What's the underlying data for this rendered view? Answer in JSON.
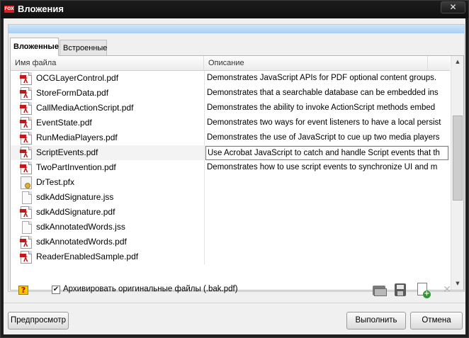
{
  "window": {
    "title": "Вложения",
    "app_icon": "foxit-icon",
    "close_glyph": "✕"
  },
  "tabs": [
    {
      "label": "Вложенные",
      "active": true
    },
    {
      "label": "Встроенные",
      "active": false
    }
  ],
  "table": {
    "columns": [
      "Имя файла",
      "Описание"
    ],
    "rows": [
      {
        "name": "OCGLayerControl.pdf",
        "icon": "pdf-icon",
        "description": "Demonstrates JavaScript APIs for PDF optional content groups."
      },
      {
        "name": "StoreFormData.pdf",
        "icon": "pdf-icon",
        "description": "Demonstrates that a searchable database can be embedded  ins"
      },
      {
        "name": "CallMediaActionScript.pdf",
        "icon": "pdf-icon",
        "description": "Demonstrates the ability to invoke ActionScript methods embed"
      },
      {
        "name": "EventState.pdf",
        "icon": "pdf-icon",
        "description": "Demonstrates two ways for event listeners to have a local persist"
      },
      {
        "name": "RunMediaPlayers.pdf",
        "icon": "pdf-icon",
        "description": "Demonstrates the use of JavaScript to cue up two media players"
      },
      {
        "name": "ScriptEvents.pdf",
        "icon": "pdf-icon",
        "description": "Use Acrobat JavaScript to catch and handle Script events that th",
        "selected": true,
        "editing": true
      },
      {
        "name": "TwoPartInvention.pdf",
        "icon": "pdf-icon",
        "description": "Demonstrates how to use script events to synchronize UI and m"
      },
      {
        "name": "DrTest.pfx",
        "icon": "certificate-icon",
        "description": ""
      },
      {
        "name": "sdkAddSignature.jss",
        "icon": "document-icon",
        "description": ""
      },
      {
        "name": "sdkAddSignature.pdf",
        "icon": "pdf-icon",
        "description": ""
      },
      {
        "name": "sdkAnnotatedWords.jss",
        "icon": "document-icon",
        "description": ""
      },
      {
        "name": "sdkAnnotatedWords.pdf",
        "icon": "pdf-icon",
        "description": ""
      },
      {
        "name": "ReaderEnabledSample.pdf",
        "icon": "pdf-icon",
        "description": ""
      }
    ]
  },
  "options": {
    "archive_label": "Архивировать оригинальные файлы (.bak.pdf)",
    "archive_checked": true,
    "check_glyph": "✔"
  },
  "toolbar": {
    "help_glyph": "?",
    "delete_glyph": "✕",
    "icons": [
      "open-folder-icon",
      "save-icon",
      "add-file-icon",
      "delete-icon"
    ]
  },
  "scrollbar": {
    "up_glyph": "▲",
    "down_glyph": "▼"
  },
  "buttons": {
    "preview": "Предпросмотр",
    "run": "Выполнить",
    "cancel": "Отмена"
  },
  "pdf_icon_glyph": "ʎ"
}
